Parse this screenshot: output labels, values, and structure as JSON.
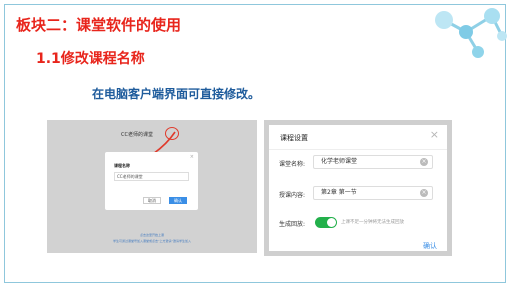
{
  "slide": {
    "section_title": "板块二：课堂软件的使用",
    "sub_title": "1.1修改课程名称",
    "caption": "在电脑客户端界面可直接修改。"
  },
  "left_screenshot": {
    "window_title": "CC老师的课堂",
    "dialog": {
      "close": "×",
      "label": "课程名称",
      "input_value": "CC老师的课堂",
      "cancel_label": "取消",
      "ok_label": "确认"
    },
    "footer_line1": "点击这里开始上课",
    "footer_line2": "学生可通过课堂号加入课堂或点击“上方邀请”邀请学生加入"
  },
  "course_settings": {
    "title": "课程设置",
    "close": "×",
    "name_label": "课堂名称:",
    "name_value": "化学老师课堂",
    "content_label": "授课内容:",
    "content_value": "第2章  第一节",
    "replay_label": "生成回放:",
    "replay_enabled": true,
    "replay_hint": "上课不足一分钟将无法生成回放",
    "confirm_label": "确认",
    "clear_glyph": "×"
  },
  "colors": {
    "title_red": "#e8251c",
    "caption_blue": "#1f5c9c",
    "toggle_green": "#23b04b",
    "link_blue": "#3a8ee6"
  }
}
